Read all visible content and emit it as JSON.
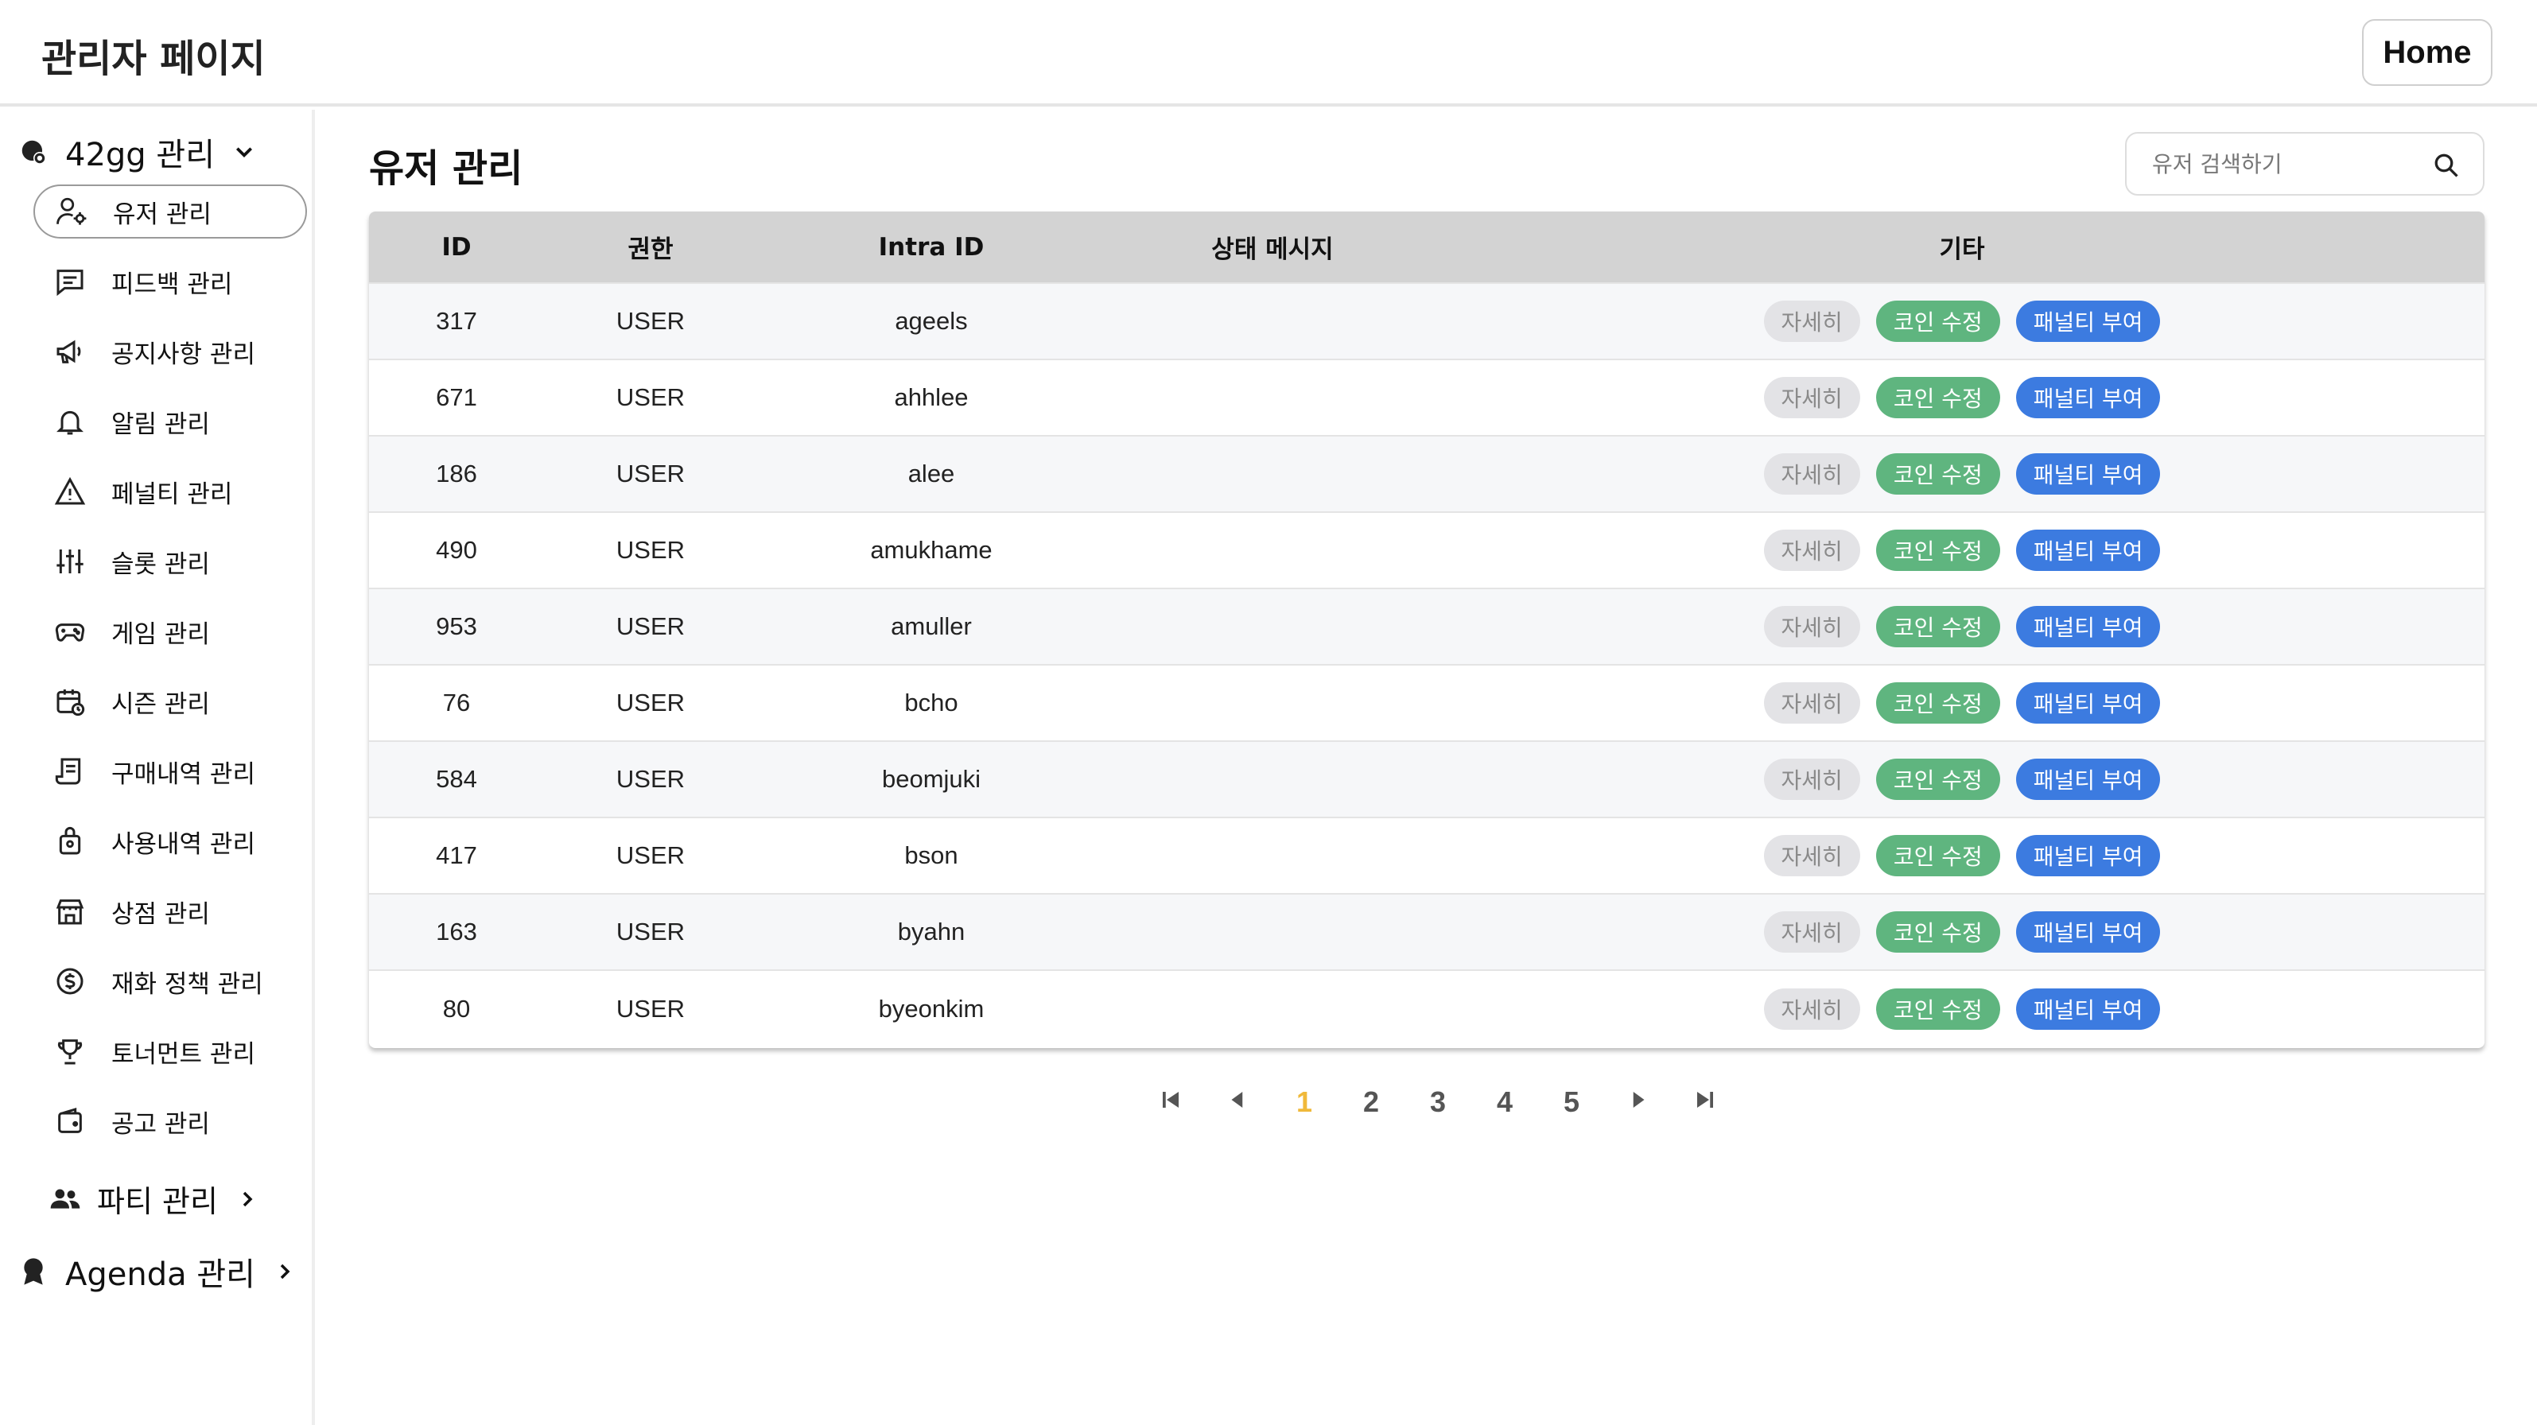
{
  "header": {
    "title": "관리자 페이지",
    "home_label": "Home"
  },
  "sidebar": {
    "section_42gg": {
      "label": "42gg 관리",
      "icon": "badge-gear-icon",
      "expanded": true
    },
    "items": [
      {
        "label": "유저 관리",
        "icon": "user-gear-icon",
        "active": true
      },
      {
        "label": "피드백 관리",
        "icon": "message-icon"
      },
      {
        "label": "공지사항 관리",
        "icon": "megaphone-icon"
      },
      {
        "label": "알림 관리",
        "icon": "bell-icon"
      },
      {
        "label": "페널티 관리",
        "icon": "warning-icon"
      },
      {
        "label": "슬롯 관리",
        "icon": "sliders-icon"
      },
      {
        "label": "게임 관리",
        "icon": "gamepad-icon"
      },
      {
        "label": "시즌 관리",
        "icon": "calendar-icon"
      },
      {
        "label": "구매내역 관리",
        "icon": "receipt-icon"
      },
      {
        "label": "사용내역 관리",
        "icon": "bag-icon"
      },
      {
        "label": "상점 관리",
        "icon": "store-icon"
      },
      {
        "label": "재화 정책 관리",
        "icon": "dollar-coin-icon"
      },
      {
        "label": "토너먼트 관리",
        "icon": "trophy-icon"
      },
      {
        "label": "공고 관리",
        "icon": "wallet-icon"
      }
    ],
    "section_party": {
      "label": "파티 관리",
      "icon": "users-icon"
    },
    "section_agenda": {
      "label": "Agenda 관리",
      "icon": "award-icon"
    }
  },
  "main": {
    "title": "유저 관리",
    "search": {
      "placeholder": "유저 검색하기",
      "value": ""
    },
    "table": {
      "headers": [
        "ID",
        "권한",
        "Intra ID",
        "상태 메시지",
        "기타"
      ],
      "action_labels": {
        "detail": "자세히",
        "coin": "코인 수정",
        "penalty": "패널티 부여"
      },
      "rows": [
        {
          "id": "317",
          "role": "USER",
          "intra_id": "ageels",
          "status": ""
        },
        {
          "id": "671",
          "role": "USER",
          "intra_id": "ahhlee",
          "status": ""
        },
        {
          "id": "186",
          "role": "USER",
          "intra_id": "alee",
          "status": ""
        },
        {
          "id": "490",
          "role": "USER",
          "intra_id": "amukhame",
          "status": ""
        },
        {
          "id": "953",
          "role": "USER",
          "intra_id": "amuller",
          "status": ""
        },
        {
          "id": "76",
          "role": "USER",
          "intra_id": "bcho",
          "status": ""
        },
        {
          "id": "584",
          "role": "USER",
          "intra_id": "beomjuki",
          "status": ""
        },
        {
          "id": "417",
          "role": "USER",
          "intra_id": "bson",
          "status": ""
        },
        {
          "id": "163",
          "role": "USER",
          "intra_id": "byahn",
          "status": ""
        },
        {
          "id": "80",
          "role": "USER",
          "intra_id": "byeonkim",
          "status": ""
        }
      ]
    },
    "pagination": {
      "pages": [
        "1",
        "2",
        "3",
        "4",
        "5"
      ],
      "current": "1"
    }
  },
  "colors": {
    "header_row": "#d3d3d3",
    "detail_pill": "#e3e3e6",
    "coin_pill": "#5fb57f",
    "penalty_pill": "#3c7be0",
    "current_page": "#f0b93a"
  }
}
